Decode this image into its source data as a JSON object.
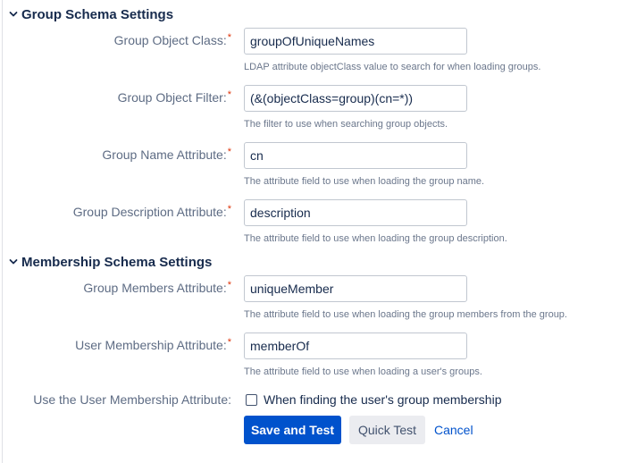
{
  "group_schema": {
    "title": "Group Schema Settings",
    "fields": [
      {
        "label": "Group Object Class:",
        "required": "*",
        "value": "groupOfUniqueNames",
        "help": "LDAP attribute objectClass value to search for when loading groups."
      },
      {
        "label": "Group Object Filter:",
        "required": "*",
        "value": "(&(objectClass=group)(cn=*))",
        "help": "The filter to use when searching group objects."
      },
      {
        "label": "Group Name Attribute:",
        "required": "*",
        "value": "cn",
        "help": "The attribute field to use when loading the group name."
      },
      {
        "label": "Group Description Attribute:",
        "required": "*",
        "value": "description",
        "help": "The attribute field to use when loading the group description."
      }
    ]
  },
  "membership_schema": {
    "title": "Membership Schema Settings",
    "fields": [
      {
        "label": "Group Members Attribute:",
        "required": "*",
        "value": "uniqueMember",
        "help": "The attribute field to use when loading the group members from the group."
      },
      {
        "label": "User Membership Attribute:",
        "required": "*",
        "value": "memberOf",
        "help": "The attribute field to use when loading a user's groups."
      }
    ],
    "use_membership": {
      "label": "Use the User Membership Attribute:",
      "checkbox_text": "When finding the user's group membership"
    }
  },
  "actions": {
    "save_and_test": "Save and Test",
    "quick_test": "Quick Test",
    "cancel": "Cancel"
  },
  "colors": {
    "primary": "#0052cc",
    "required": "#de350b"
  },
  "icons": {
    "section_toggle": "chevron-down-icon"
  }
}
